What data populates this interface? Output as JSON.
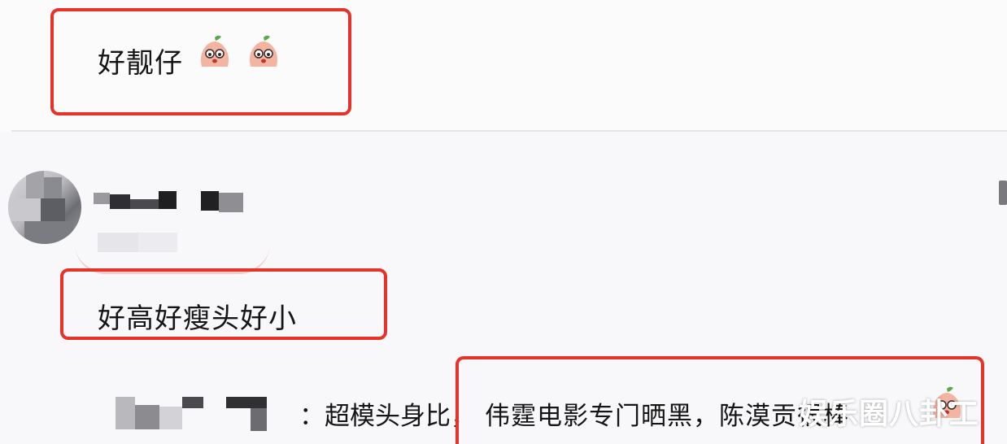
{
  "comments": [
    {
      "text": "好靓仔",
      "emoji": "peach-face-emoji"
    },
    {
      "text": "好高好瘦头好小"
    }
  ],
  "reply": {
    "prefix": "：超模头身比，",
    "highlighted_text": "伟霆电影专门晒黑，陈漠贡很棒"
  },
  "watermark": "娱乐圈八卦工",
  "colors": {
    "highlight_border": "#e6332a",
    "text": "#151515",
    "divider": "#e3e3e8",
    "background": "#f8f8fa"
  }
}
